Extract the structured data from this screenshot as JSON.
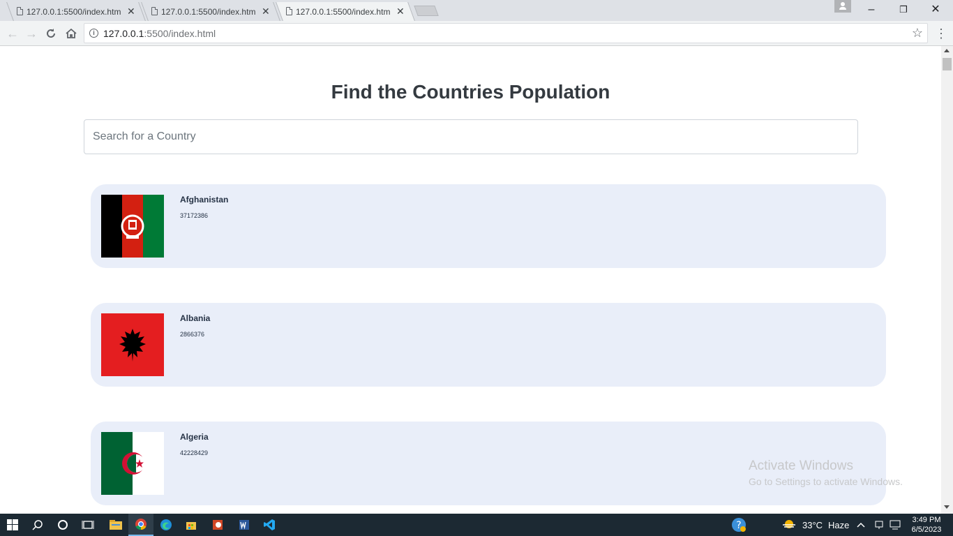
{
  "browser": {
    "tabs": [
      {
        "title": "127.0.0.1:5500/index.html",
        "active": false
      },
      {
        "title": "127.0.0.1:5500/index.html",
        "active": false
      },
      {
        "title": "127.0.0.1:5500/index.html",
        "active": true
      }
    ],
    "url_host": "127.0.0.1",
    "url_rest": ":5500/index.html"
  },
  "page": {
    "heading": "Find the Countries Population",
    "search_placeholder": "Search for a Country",
    "countries": [
      {
        "name": "Afghanistan",
        "population": "37172386"
      },
      {
        "name": "Albania",
        "population": "2866376"
      },
      {
        "name": "Algeria",
        "population": "42228429"
      }
    ]
  },
  "watermark": {
    "title": "Activate Windows",
    "subtitle": "Go to Settings to activate Windows."
  },
  "taskbar": {
    "weather_temp": "33°C",
    "weather_desc": "Haze",
    "time": "3:49 PM",
    "date": "6/5/2023"
  },
  "colors": {
    "card_bg": "#e9eef9",
    "heading": "#343a40",
    "taskbar_bg": "#1c2933"
  }
}
